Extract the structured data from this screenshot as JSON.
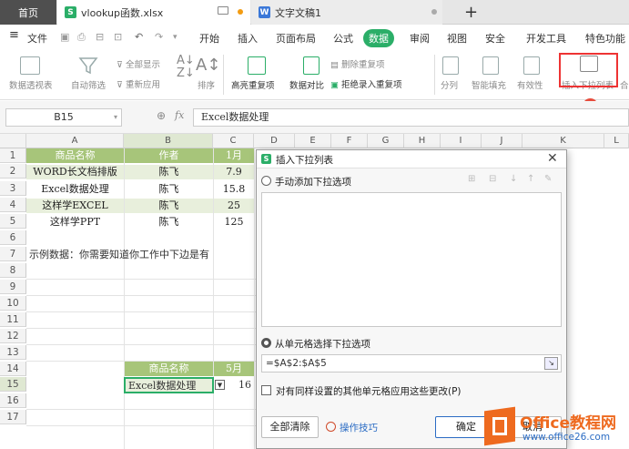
{
  "tabs": {
    "home": "首页",
    "xlsx": "vlookup函数.xlsx",
    "doc": "文字文稿1",
    "add": "+"
  },
  "menu": {
    "file": "文件",
    "items": [
      "开始",
      "插入",
      "页面布局",
      "公式",
      "数据",
      "审阅",
      "视图",
      "安全",
      "开发工具",
      "特色功能"
    ],
    "active": "数据"
  },
  "toolbar": {
    "pivot": "数据透视表",
    "autofilter": "自动筛选",
    "showall": "全部显示",
    "reapply": "重新应用",
    "sort": "排序",
    "highlight_dup": "高亮重复项",
    "compare": "数据对比",
    "remove_dup": "删除重复项",
    "reject_dup": "拒绝录入重复项",
    "split": "分列",
    "smart_fill": "智能填充",
    "validity": "有效性",
    "insert_dropdown": "插入下拉列表",
    "more": "合"
  },
  "badge": "1",
  "formula_bar": {
    "cell_ref": "B15",
    "fx": "fx",
    "content": "Excel数据处理"
  },
  "columns": [
    "A",
    "B",
    "C",
    "D",
    "E",
    "F",
    "G",
    "H",
    "I",
    "J",
    "K",
    "L"
  ],
  "rows": [
    "1",
    "2",
    "3",
    "4",
    "5",
    "6",
    "7",
    "8",
    "9",
    "10",
    "11",
    "12",
    "13",
    "14",
    "15",
    "16",
    "17"
  ],
  "table": {
    "header": [
      "商品名称",
      "作者",
      "1月"
    ],
    "rows": [
      [
        "WORD长文档排版",
        "陈飞",
        "7.9"
      ],
      [
        "Excel数据处理",
        "陈飞",
        "15.8"
      ],
      [
        "这样学EXCEL",
        "陈飞",
        "25"
      ],
      [
        "这样学PPT",
        "陈飞",
        "125"
      ]
    ]
  },
  "note": "示例数据：你需要知道你工作中下边是有",
  "lookup": {
    "header": [
      "商品名称",
      "5月"
    ],
    "value": "Excel数据处理",
    "result": "16"
  },
  "dialog": {
    "title": "插入下拉列表",
    "option_manual": "手动添加下拉选项",
    "option_cells": "从单元格选择下拉选项",
    "range": "=$A$2:$A$5",
    "apply_all": "对有同样设置的其他单元格应用这些更改(P)",
    "clear": "全部清除",
    "tips": "操作技巧",
    "ok": "确定",
    "cancel": "取消"
  },
  "watermark": {
    "brand": "Office教程网",
    "url": "www.office26.com"
  },
  "colors": {
    "accent": "#2bae68",
    "header_green": "#a7c57a",
    "row_green": "#e8efdc",
    "badge": "#e74c3c",
    "watermark": "#ee6a1f"
  }
}
